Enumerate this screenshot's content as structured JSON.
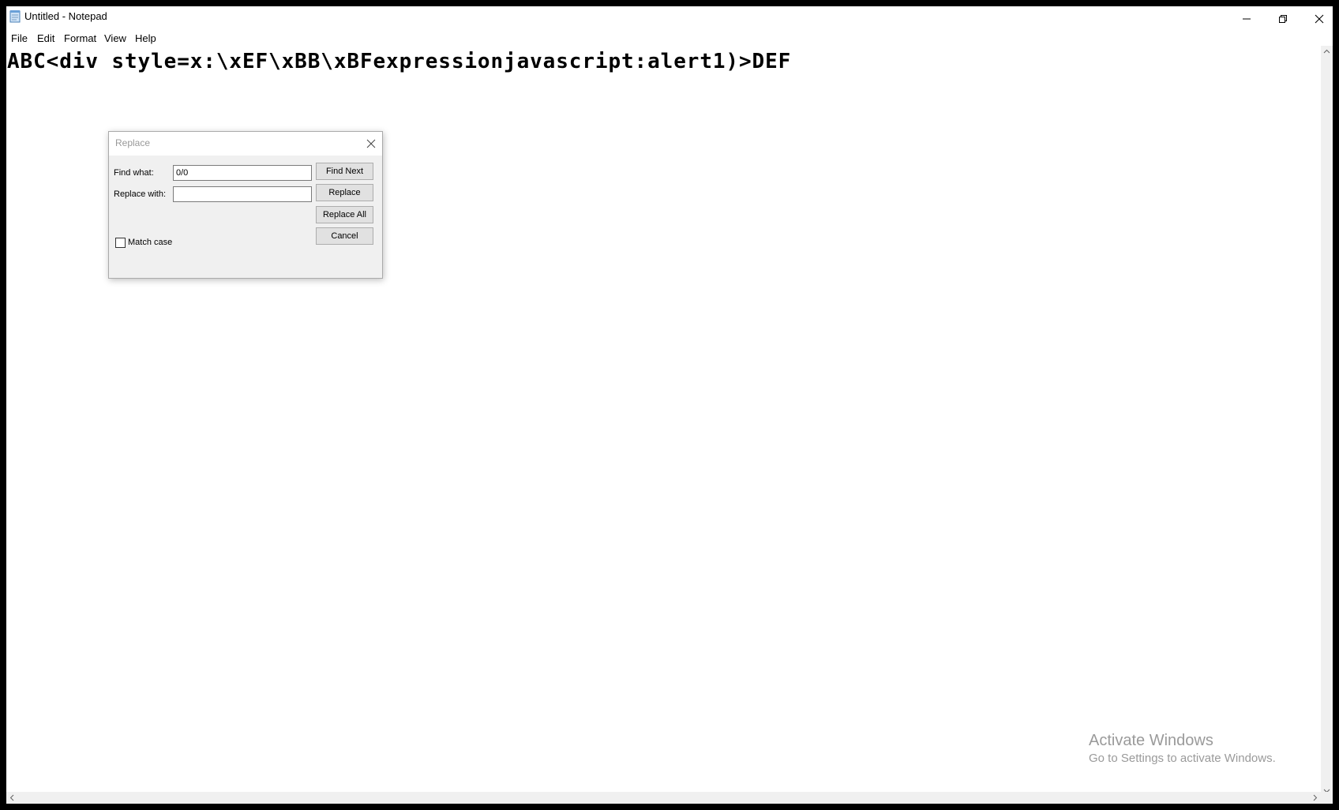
{
  "window": {
    "title": "Untitled - Notepad"
  },
  "menu": [
    "File",
    "Edit",
    "Format",
    "View",
    "Help"
  ],
  "editor": {
    "content": "ABC<div style=x:\\xEF\\xBB\\xBFexpressionjavascript:alert1)>DEF"
  },
  "dialog": {
    "title": "Replace",
    "find_label": "Find what:",
    "find_value": "0/0",
    "replace_label": "Replace with:",
    "replace_value": "",
    "buttons": {
      "find_next": "Find Next",
      "replace": "Replace",
      "replace_all": "Replace All",
      "cancel": "Cancel"
    },
    "match_case_label": "Match case",
    "match_case_checked": false
  },
  "watermark": {
    "title": "Activate Windows",
    "subtitle": "Go to Settings to activate Windows."
  }
}
